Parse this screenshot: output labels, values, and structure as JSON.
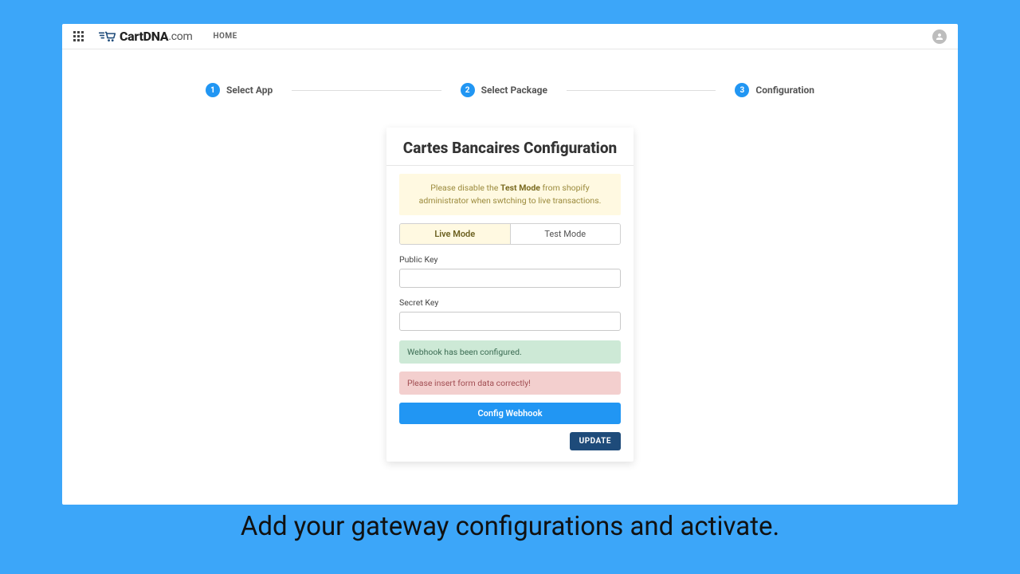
{
  "brand": {
    "name_strong": "CartDNA",
    "name_suffix": ".com"
  },
  "nav": {
    "home": "HOME"
  },
  "stepper": {
    "steps": [
      {
        "num": "1",
        "label": "Select App"
      },
      {
        "num": "2",
        "label": "Select Package"
      },
      {
        "num": "3",
        "label": "Configuration"
      }
    ]
  },
  "card": {
    "title": "Cartes Bancaires Configuration",
    "warning_pre": "Please disable the ",
    "warning_bold": "Test Mode",
    "warning_post": " from shopify administrator when swtching to live transactions.",
    "mode": {
      "live": "Live Mode",
      "test": "Test Mode"
    },
    "fields": {
      "public_key_label": "Public Key",
      "public_key_value": "",
      "secret_key_label": "Secret Key",
      "secret_key_value": ""
    },
    "alerts": {
      "success": "Webhook has been configured.",
      "error": "Please insert form data correctly!"
    },
    "buttons": {
      "config_webhook": "Config Webhook",
      "update": "UPDATE"
    }
  },
  "caption": "Add your gateway configurations and activate."
}
